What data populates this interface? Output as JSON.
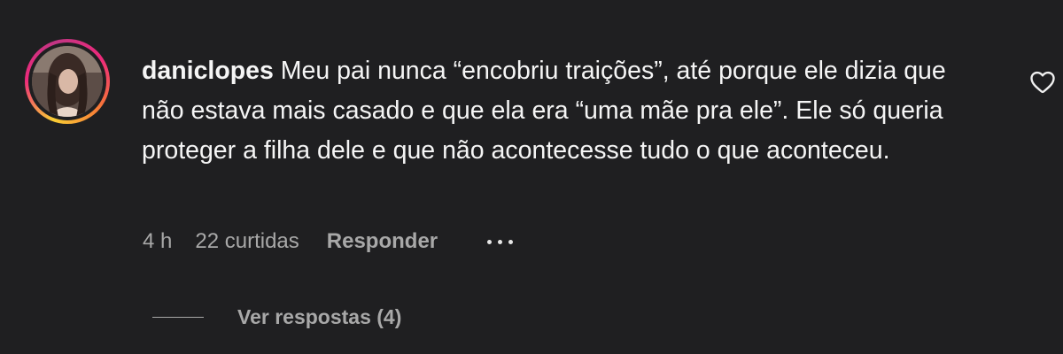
{
  "comment": {
    "username": "daniclopes",
    "text": "Meu pai nunca “encobriu traições”, até porque ele dizia que não estava mais casado e que ela era “uma mãe pra ele”. Ele só queria proteger a filha dele e que não acontecesse tudo o que aconteceu.",
    "time": "4 h",
    "likes": "22 curtidas",
    "reply_label": "Responder",
    "view_replies": "Ver respostas (4)",
    "icons": {
      "like": "heart-outline-icon",
      "more": "more-options-icon"
    }
  },
  "colors": {
    "background": "#1f1f21",
    "text": "#f5f5f5",
    "secondary": "#a8a8a8"
  }
}
